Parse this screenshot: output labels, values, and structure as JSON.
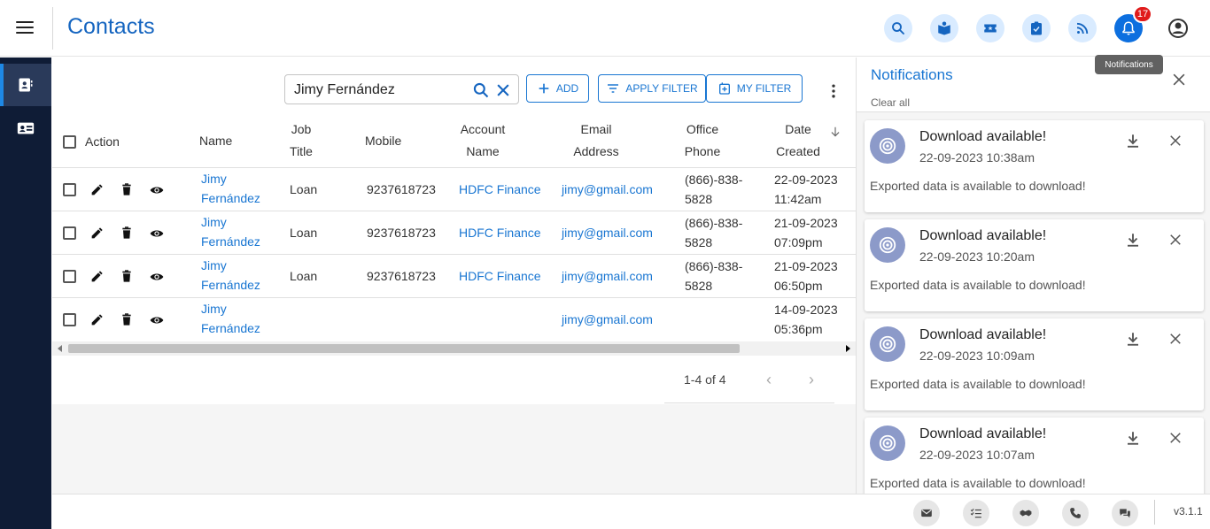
{
  "header": {
    "title": "Contacts",
    "notification_count": "17",
    "tooltip": "Notifications",
    "icons": [
      "search-icon",
      "contact-book-icon",
      "ticket-icon",
      "task-icon",
      "rss-icon",
      "bell-icon",
      "profile-icon"
    ]
  },
  "toolbar": {
    "search_value": "Jimy Fernández",
    "add_label": "ADD",
    "apply_filter_label": "APPLY FILTER",
    "my_filter_label": "MY FILTER"
  },
  "table": {
    "headers": {
      "action": "Action",
      "name": "Name",
      "job_title_1": "Job",
      "job_title_2": "Title",
      "mobile": "Mobile",
      "account_name_1": "Account",
      "account_name_2": "Name",
      "email_1": "Email",
      "email_2": "Address",
      "office_phone_1": "Office",
      "office_phone_2": "Phone",
      "date_created_1": "Date",
      "date_created_2": "Created"
    },
    "rows": [
      {
        "name1": "Jimy",
        "name2": "Fernández",
        "job": "Loan",
        "mobile": "9237618723",
        "account": "HDFC Finance",
        "email": "jimy@gmail.com",
        "phone1": "(866)-838-",
        "phone2": "5828",
        "date1": "22-09-2023",
        "date2": "11:42am"
      },
      {
        "name1": "Jimy",
        "name2": "Fernández",
        "job": "Loan",
        "mobile": "9237618723",
        "account": "HDFC Finance",
        "email": "jimy@gmail.com",
        "phone1": "(866)-838-",
        "phone2": "5828",
        "date1": "21-09-2023",
        "date2": "07:09pm"
      },
      {
        "name1": "Jimy",
        "name2": "Fernández",
        "job": "Loan",
        "mobile": "9237618723",
        "account": "HDFC Finance",
        "email": "jimy@gmail.com",
        "phone1": "(866)-838-",
        "phone2": "5828",
        "date1": "21-09-2023",
        "date2": "06:50pm"
      },
      {
        "name1": "Jimy",
        "name2": "Fernández",
        "job": "",
        "mobile": "",
        "account": "",
        "email": "jimy@gmail.com",
        "phone1": "",
        "phone2": "",
        "date1": "14-09-2023",
        "date2": "05:36pm"
      }
    ]
  },
  "pagination": {
    "range": "1-4 of 4"
  },
  "notifications": {
    "title": "Notifications",
    "clear_all": "Clear all",
    "items": [
      {
        "title": "Download available!",
        "time": "22-09-2023 10:38am",
        "message": "Exported data is available to download!"
      },
      {
        "title": "Download available!",
        "time": "22-09-2023 10:20am",
        "message": "Exported data is available to download!"
      },
      {
        "title": "Download available!",
        "time": "22-09-2023 10:09am",
        "message": "Exported data is available to download!"
      },
      {
        "title": "Download available!",
        "time": "22-09-2023 10:07am",
        "message": "Exported data is available to download!"
      }
    ]
  },
  "footer": {
    "version": "v3.1.1",
    "icons": [
      "email-icon",
      "checklist-icon",
      "handshake-icon",
      "phone-icon",
      "chat-icon"
    ]
  },
  "colors": {
    "accent": "#1976d2",
    "sidebar": "#0f1c36",
    "badge": "#e01b1b"
  }
}
